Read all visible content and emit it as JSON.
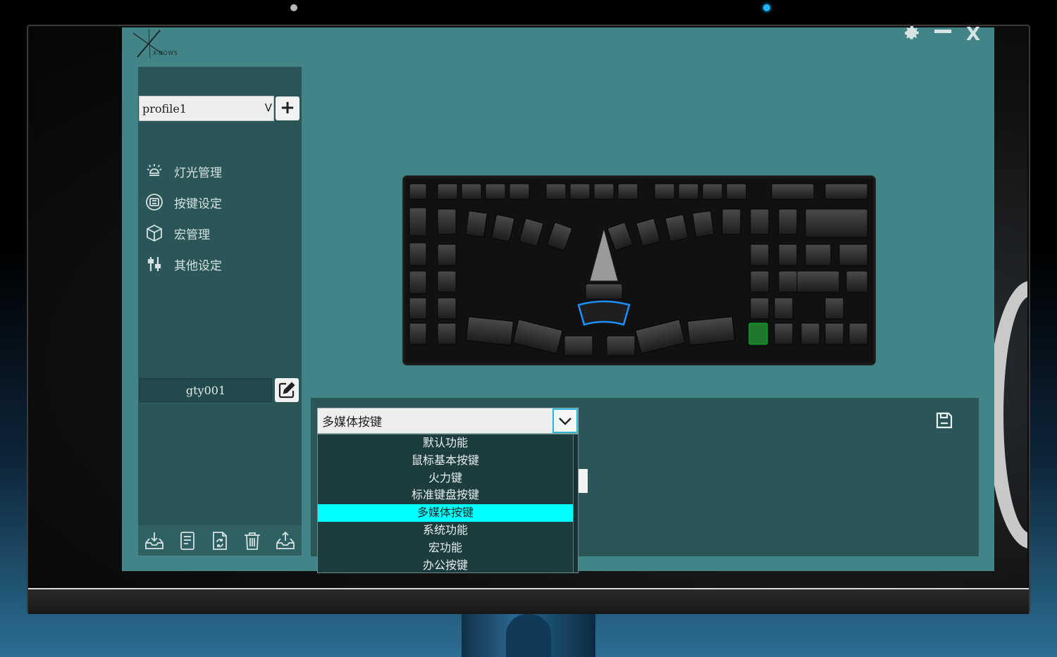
{
  "app": {
    "logo_text": "X-BOWS",
    "window_controls": {
      "settings_icon": "gear-icon",
      "minimize_icon": "minus-icon",
      "close_glyph": "X"
    }
  },
  "sidebar": {
    "profile": {
      "selected": "profile1",
      "chevron": "V",
      "add_label": "+"
    },
    "menu": [
      {
        "label": "灯光管理",
        "icon": "light-bulb-icon"
      },
      {
        "label": "按键设定",
        "icon": "keypad-icon"
      },
      {
        "label": "宏管理",
        "icon": "cube-icon"
      },
      {
        "label": "其他设定",
        "icon": "sliders-icon"
      }
    ],
    "user": {
      "name": "gty001",
      "edit_icon": "edit-icon"
    },
    "toolbar": [
      {
        "icon": "import-icon"
      },
      {
        "icon": "document-icon"
      },
      {
        "icon": "refresh-file-icon"
      },
      {
        "icon": "trash-icon"
      },
      {
        "icon": "export-icon"
      }
    ]
  },
  "key_panel": {
    "category_select": {
      "selected": "多媒体按键",
      "options": [
        "默认功能",
        "鼠标基本按键",
        "火力键",
        "标准键盘按键",
        "多媒体按键",
        "系统功能",
        "宏功能",
        "办公按键"
      ],
      "selected_index": 4
    },
    "save_icon": "save-icon"
  },
  "colors": {
    "app_bg": "#438486",
    "panel_bg": "#2a5658",
    "highlight": "#00ffff",
    "focus_border": "#2fb6d0"
  }
}
